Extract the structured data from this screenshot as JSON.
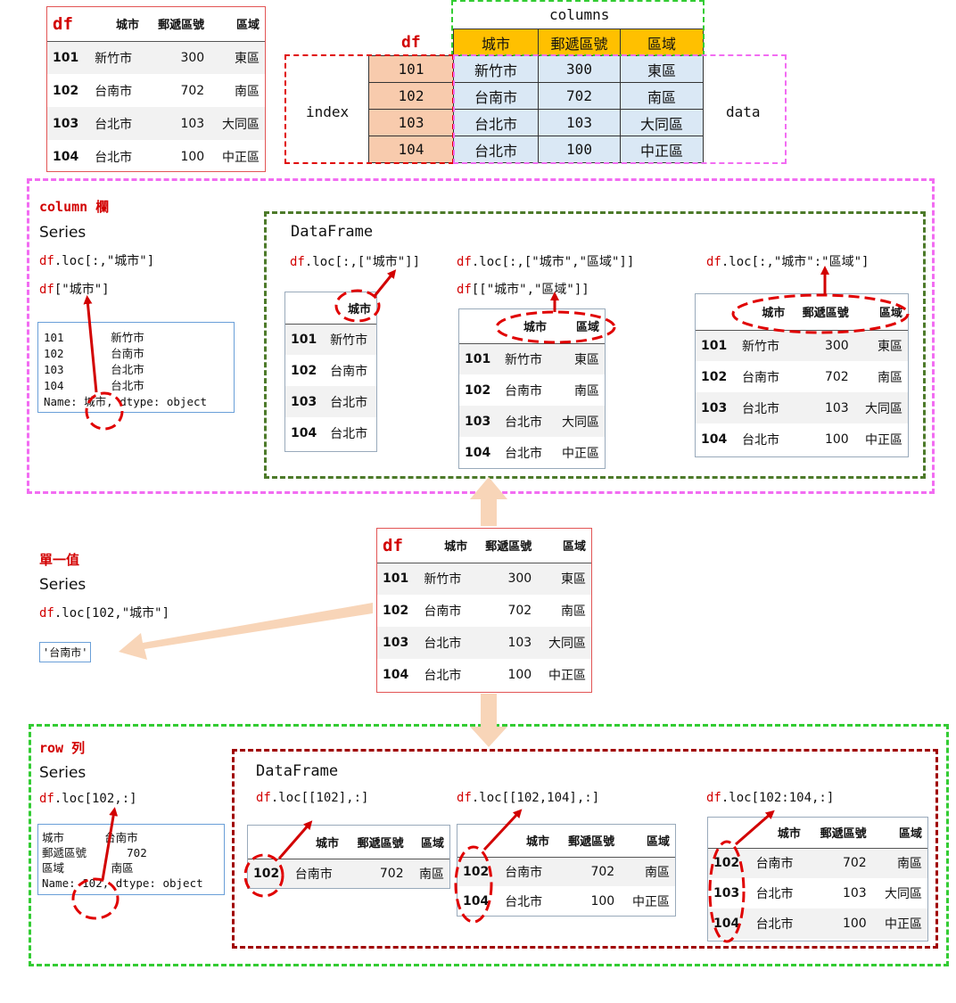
{
  "df_label": "df",
  "columns_label": "columns",
  "index_label": "index",
  "data_label": "data",
  "dataframe_label": "DataFrame",
  "series_label": "Series",
  "col_headers": [
    "城市",
    "郵遞區號",
    "區域"
  ],
  "rows": [
    {
      "idx": "101",
      "city": "新竹市",
      "zip": "300",
      "region": "東區"
    },
    {
      "idx": "102",
      "city": "台南市",
      "zip": "702",
      "region": "南區"
    },
    {
      "idx": "103",
      "city": "台北市",
      "zip": "103",
      "region": "大同區"
    },
    {
      "idx": "104",
      "city": "台北市",
      "zip": "100",
      "region": "中正區"
    }
  ],
  "column_section": {
    "title": "column 欄",
    "code1_df": "df",
    "code1_rest": ".loc[:,\"城市\"]",
    "code2_df": "df",
    "code2_rest": "[\"城市\"]",
    "series_output": "101       新竹市\n102       台南市\n103       台北市\n104       台北市\nName: 城市, dtype: object",
    "ex1_df": "df",
    "ex1_rest": ".loc[:,[\"城市\"]]",
    "ex2a_df": "df",
    "ex2a_rest": ".loc[:,[\"城市\",\"區域\"]]",
    "ex2b_df": "df",
    "ex2b_rest": "[[\"城市\",\"區域\"]]",
    "ex3_df": "df",
    "ex3_rest": ".loc[:,\"城市\":\"區域\"]"
  },
  "single_section": {
    "title": "單一值",
    "code_df": "df",
    "code_rest": ".loc[102,\"城市\"]",
    "output": "'台南市'"
  },
  "row_section": {
    "title": "row 列",
    "code_df": "df",
    "code_rest": ".loc[102,:]",
    "series_output": "城市      台南市\n郵遞區號      702\n區域       南區\nName: 102, dtype: object",
    "ex1_df": "df",
    "ex1_rest": ".loc[[102],:]",
    "ex2_df": "df",
    "ex2_rest": ".loc[[102,104],:]",
    "ex3_df": "df",
    "ex3_rest": ".loc[102:104,:]"
  },
  "colors": {
    "index_fill": "#f8cbad",
    "header_fill": "#ffc000",
    "data_fill": "#dae8f5",
    "red": "#d20000",
    "magenta": "#f26cf2",
    "green": "#33cc33",
    "darkgreen": "#4d7a2a",
    "darkred": "#a00000",
    "arrow": "#f8d5b8"
  }
}
